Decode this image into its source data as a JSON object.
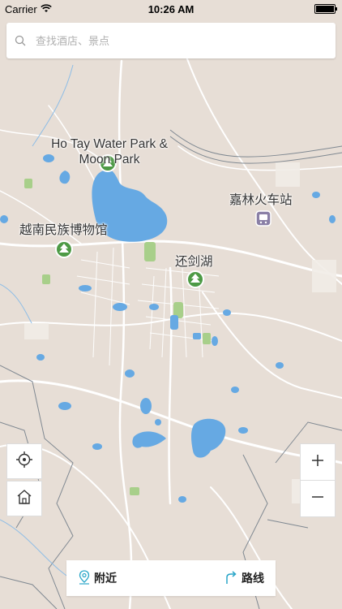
{
  "status_bar": {
    "carrier": "Carrier",
    "time": "10:26 AM"
  },
  "search": {
    "placeholder": "查找酒店、景点"
  },
  "map": {
    "labels": [
      {
        "text": "Ho Tay Water Park & Moon Park"
      },
      {
        "text": "越南民族博物馆"
      },
      {
        "text": "还剑湖"
      },
      {
        "text": "嘉林火车站"
      }
    ]
  },
  "bottom_bar": {
    "nearby_label": "附近",
    "route_label": "路线"
  },
  "colors": {
    "land": "#e7ded6",
    "water": "#66a9e3",
    "park": "#a8cf8a",
    "poi_green": "#4d9a45",
    "accent": "#2aa6c8"
  }
}
